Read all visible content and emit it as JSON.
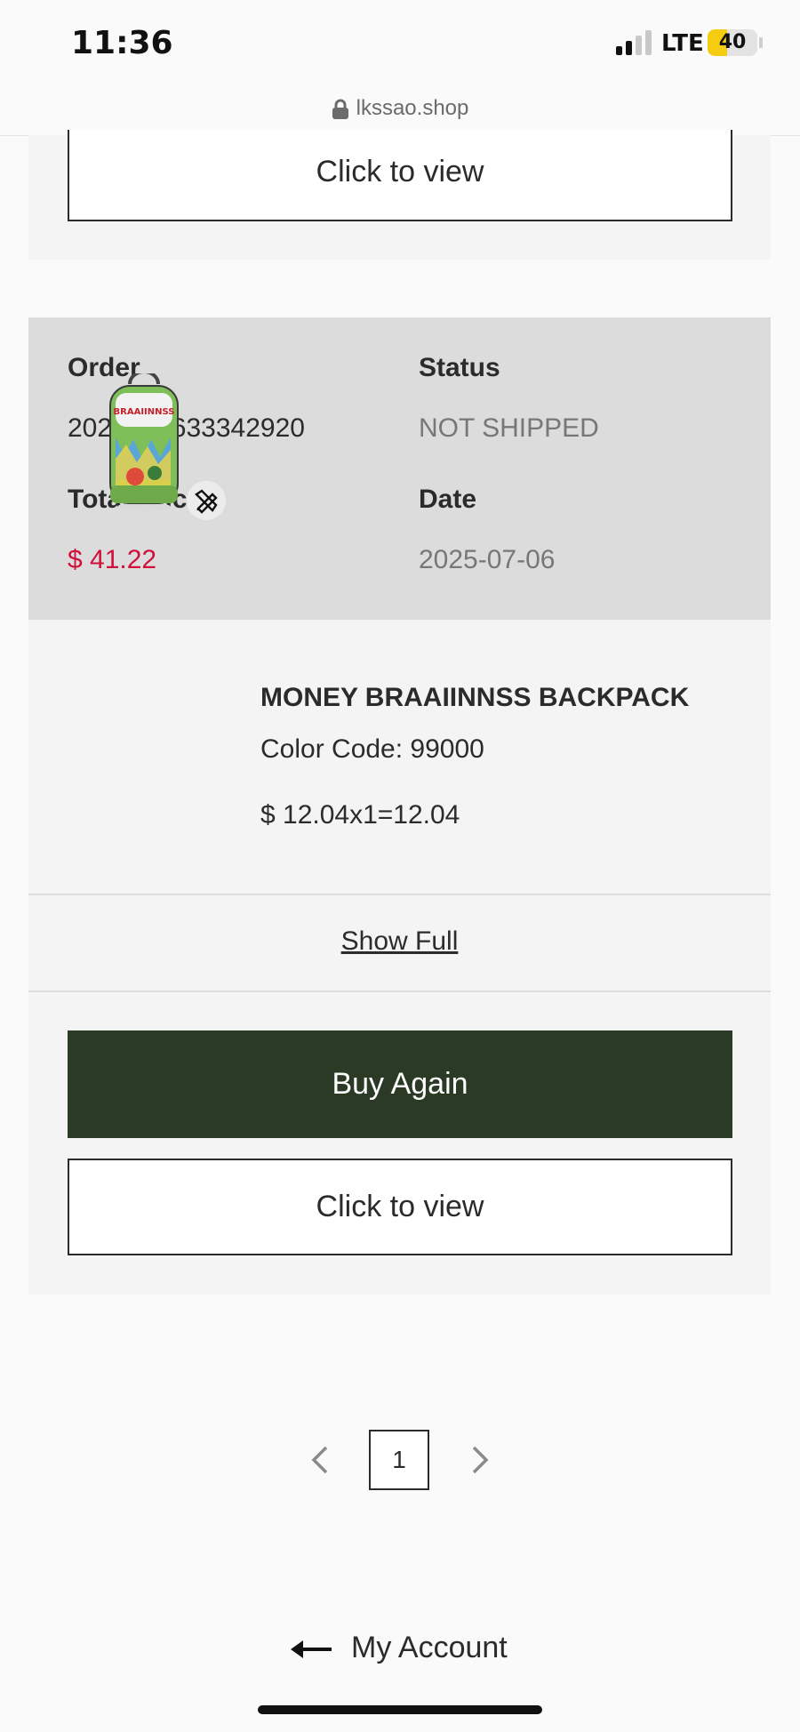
{
  "status_bar": {
    "time": "11:36",
    "network": "LTE",
    "battery": "40",
    "battery_level": 0.4,
    "battery_color": "#f5cc10"
  },
  "browser": {
    "url": "lkssao.shop"
  },
  "previous_order": {
    "view_label": "Click to view"
  },
  "order": {
    "order_label": "Order",
    "order_number": "2025070633342920",
    "status_label": "Status",
    "status_value": "NOT SHIPPED",
    "total_label": "Total Price",
    "total_value": "$ 41.22",
    "date_label": "Date",
    "date_value": "2025-07-06",
    "item": {
      "name": "MONEY BRAAIINNSS BACKPACK",
      "color_code": "Color Code: 99000",
      "price_line": "$ 12.04x1=12.04",
      "thumb_text": "BRAAIINNSS"
    },
    "show_full_label": "Show Full",
    "buy_again_label": "Buy Again",
    "view_label": "Click to view"
  },
  "pagination": {
    "current_page": "1"
  },
  "footer": {
    "back_label": "My Account"
  },
  "colors": {
    "accent_dark_green": "#2b3a24",
    "price_red": "#d0103a",
    "summary_bg": "#dcdcdc"
  }
}
